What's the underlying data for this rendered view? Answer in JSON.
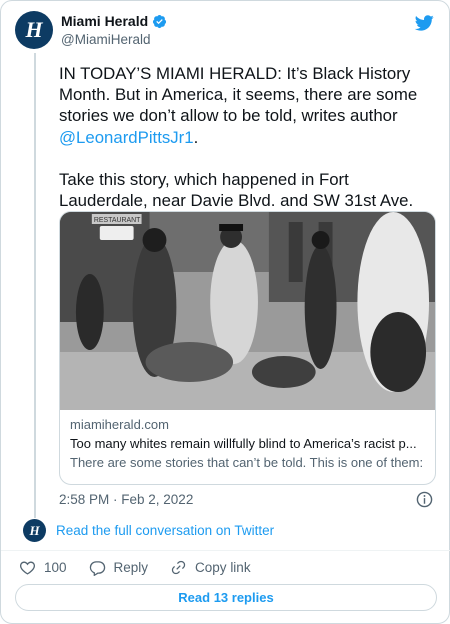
{
  "account": {
    "display_name": "Miami Herald",
    "handle": "@MiamiHerald",
    "avatar_letter": "H",
    "verified": true
  },
  "tweet": {
    "text_part1": "IN TODAY’S MIAMI HERALD: It’s Black History Month. But in America, it seems, there are some stories we don’t allow to be told, writes author ",
    "mention": "@LeonardPittsJr1",
    "text_part2": ".\n\nTake this story, which happened in Fort Lauderdale, near Davie Blvd. and SW 31st Ave.",
    "emoji": "🧵",
    "timestamp": "2:58 PM · Feb 2, 2022"
  },
  "link_card": {
    "domain": "miamiherald.com",
    "title": "Too many whites remain willfully blind to America’s racist p...",
    "description": "There are some stories that can’t be told. This is one of them:",
    "photo_sign_text": "RESTAURANT"
  },
  "conversation": {
    "link_text": "Read the full conversation on Twitter"
  },
  "actions": {
    "like_count": "100",
    "reply_label": "Reply",
    "copy_label": "Copy link"
  },
  "replies_button": "Read 13 replies",
  "colors": {
    "accent": "#1d9bf0",
    "text": "#0f1419",
    "muted": "#536471",
    "border": "#cfd9de",
    "avatar": "#0d3b63"
  },
  "icons": [
    "verified-badge-icon",
    "twitter-bird-icon",
    "info-icon",
    "heart-icon",
    "reply-bubble-icon",
    "link-icon"
  ]
}
